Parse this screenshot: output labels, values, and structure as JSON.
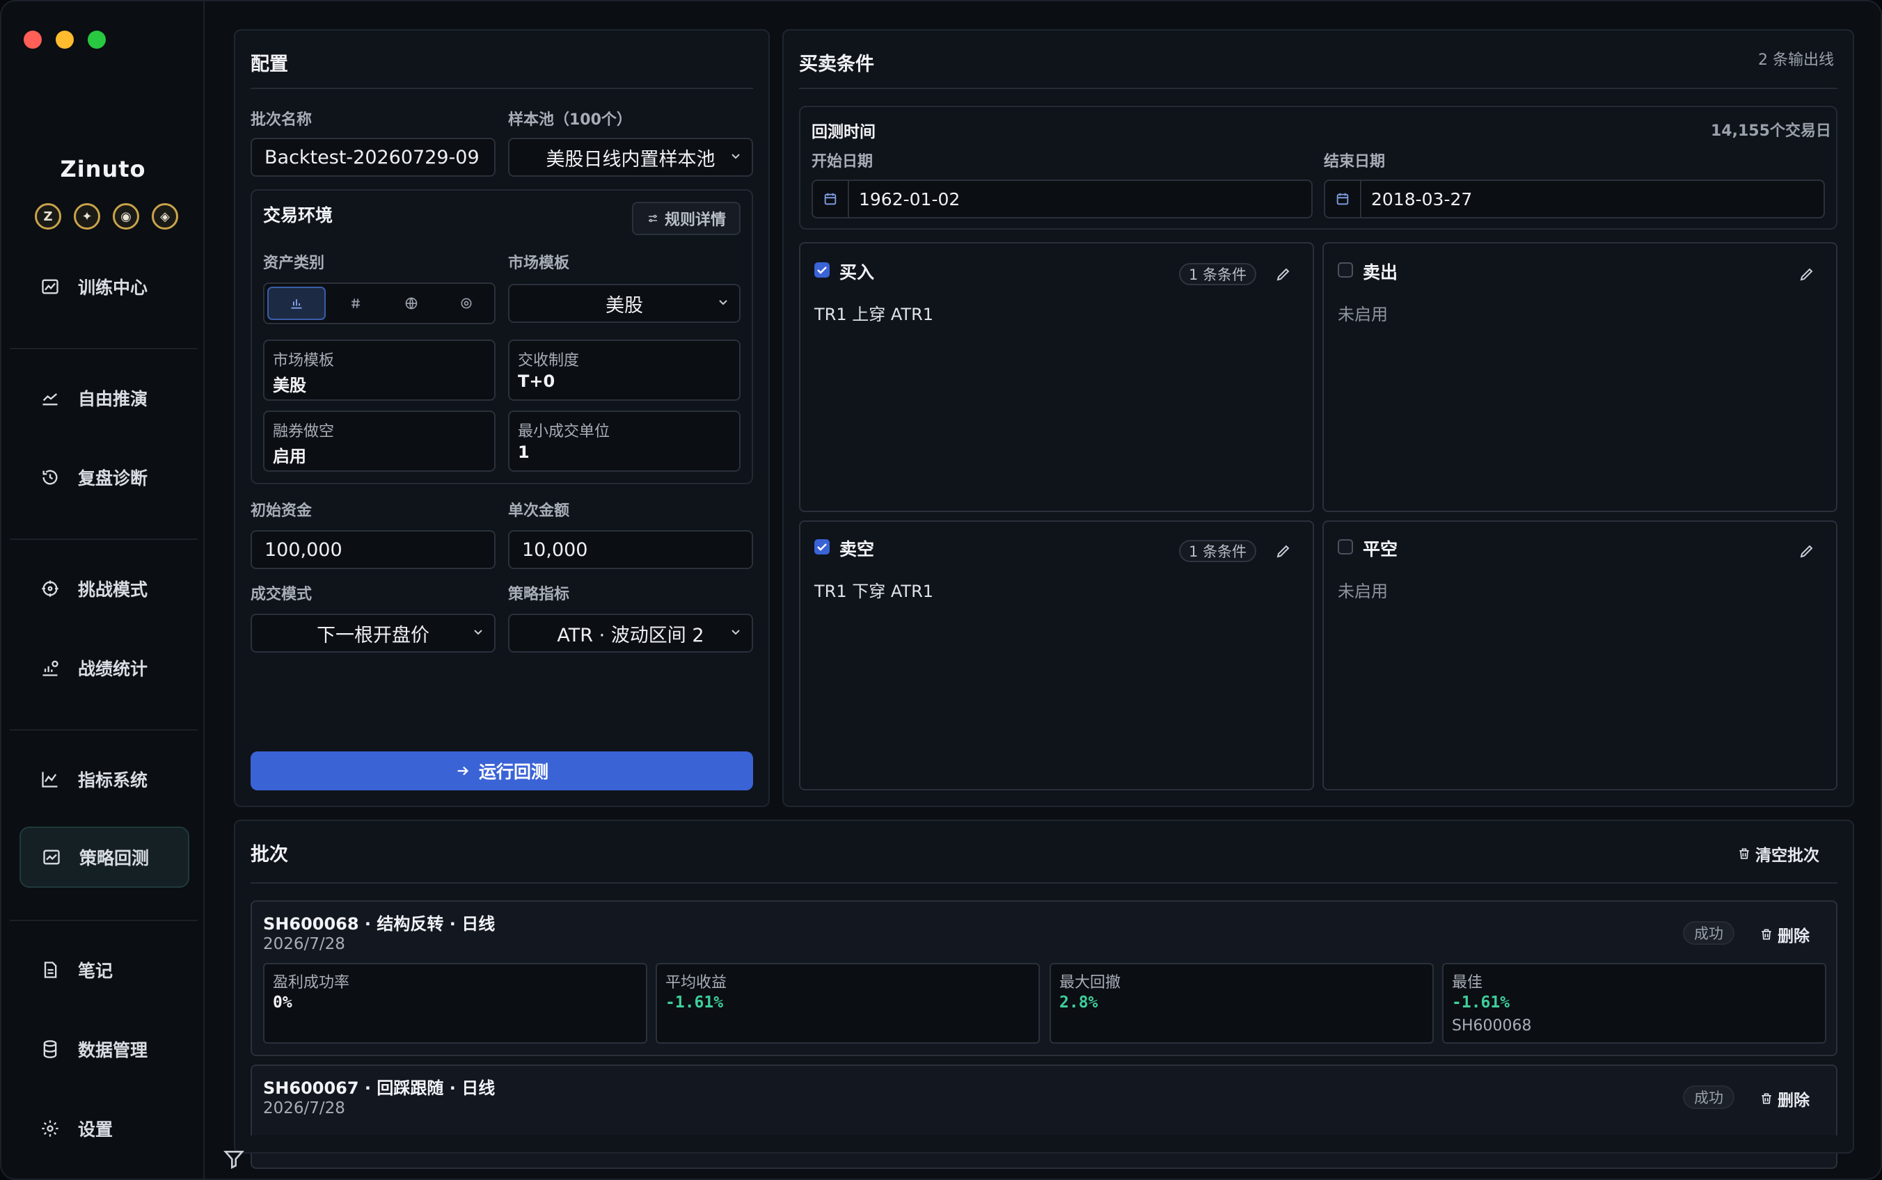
{
  "app": {
    "name": "Zinuto",
    "badges": [
      "Z",
      "✦",
      "◉",
      "◈"
    ]
  },
  "sidebar": {
    "items": [
      {
        "label": "训练中心",
        "icon": "image-chart-icon"
      },
      {
        "label": "自由推演",
        "icon": "trend-line-icon"
      },
      {
        "label": "复盘诊断",
        "icon": "history-icon"
      },
      {
        "label": "挑战模式",
        "icon": "target-icon"
      },
      {
        "label": "战绩统计",
        "icon": "stats-icon"
      },
      {
        "label": "指标系统",
        "icon": "line-chart-icon"
      },
      {
        "label": "策略回测",
        "icon": "backtest-icon",
        "active": true
      },
      {
        "label": "笔记",
        "icon": "note-icon"
      },
      {
        "label": "数据管理",
        "icon": "database-icon"
      },
      {
        "label": "设置",
        "icon": "gear-icon"
      }
    ]
  },
  "config": {
    "title": "配置",
    "batch_name_label": "批次名称",
    "batch_name_value": "Backtest-20260729-09",
    "pool_label": "样本池（100个）",
    "pool_value": "美股日线内置样本池",
    "env": {
      "title": "交易环境",
      "rules_button": "规则详情",
      "asset_label": "资产类别",
      "market_label": "市场模板",
      "market_value": "美股",
      "info": [
        {
          "k": "市场模板",
          "v": "美股"
        },
        {
          "k": "交收制度",
          "v": "T+0"
        },
        {
          "k": "融券做空",
          "v": "启用"
        },
        {
          "k": "最小成交单位",
          "v": "1"
        }
      ]
    },
    "capital_label": "初始资金",
    "capital_value": "100,000",
    "single_label": "单次金额",
    "single_value": "10,000",
    "fill_mode_label": "成交模式",
    "fill_mode_value": "下一根开盘价",
    "indicator_label": "策略指标",
    "indicator_value": "ATR · 波动区间 2",
    "run_button": "运行回测"
  },
  "trade": {
    "title": "买卖条件",
    "output_lines": "2 条输出线",
    "range": {
      "title": "回测时间",
      "count": "14,155个交易日",
      "start_label": "开始日期",
      "start_value": "1962-01-02",
      "end_label": "结束日期",
      "end_value": "2018-03-27"
    },
    "cards": [
      {
        "title": "买入",
        "checked": true,
        "pill": "1 条条件",
        "text": "TR1 上穿 ATR1"
      },
      {
        "title": "卖出",
        "checked": false,
        "pill": "",
        "text": "未启用"
      },
      {
        "title": "卖空",
        "checked": true,
        "pill": "1 条条件",
        "text": "TR1 下穿 ATR1"
      },
      {
        "title": "平空",
        "checked": false,
        "pill": "",
        "text": "未启用"
      }
    ]
  },
  "batches": {
    "title": "批次",
    "clear_button": "清空批次",
    "rows": [
      {
        "title": "SH600068 · 结构反转 · 日线",
        "date": "2026/7/28",
        "status": "成功",
        "delete": "删除",
        "metrics": [
          {
            "k": "盈利成功率",
            "v": "0%",
            "color": "#f1f3f6"
          },
          {
            "k": "平均收益",
            "v": "-1.61%",
            "color": "#3ecf9a"
          },
          {
            "k": "最大回撤",
            "v": "2.8%",
            "color": "#3ecf9a"
          },
          {
            "k": "最佳",
            "v": "-1.61%",
            "color": "#3ecf9a",
            "sub": "SH600068"
          }
        ]
      },
      {
        "title": "SH600067 · 回踩跟随 · 日线",
        "date": "2026/7/28",
        "status": "成功",
        "delete": "删除"
      }
    ]
  },
  "colors": {
    "accent": "#3a63d6",
    "positive": "#3ecf9a",
    "background": "#0b0e13"
  }
}
